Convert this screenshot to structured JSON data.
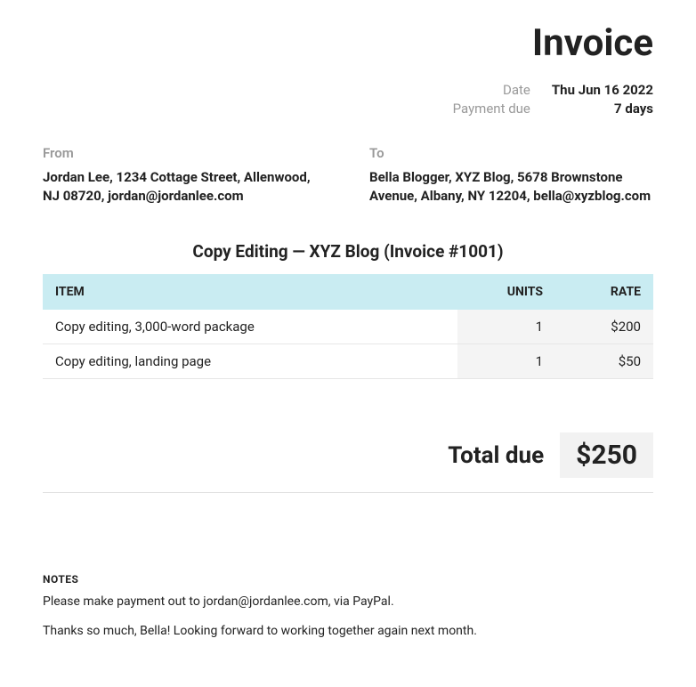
{
  "title": "Invoice",
  "meta": {
    "date_label": "Date",
    "date_value": "Thu Jun 16 2022",
    "payment_due_label": "Payment due",
    "payment_due_value": "7 days"
  },
  "from": {
    "label": "From",
    "details": "Jordan Lee, 1234 Cottage Street, Allenwood, NJ 08720, jordan@jordanlee.com"
  },
  "to": {
    "label": "To",
    "details": "Bella Blogger, XYZ Blog, 5678 Brownstone Avenue, Albany, NY 12204, bella@xyzblog.com"
  },
  "invoice_heading": "Copy Editing — XYZ Blog (Invoice #1001)",
  "table": {
    "headers": {
      "item": "ITEM",
      "units": "UNITS",
      "rate": "RATE"
    },
    "rows": [
      {
        "item": "Copy editing, 3,000-word package",
        "units": "1",
        "rate": "$200"
      },
      {
        "item": "Copy editing, landing page",
        "units": "1",
        "rate": "$50"
      }
    ]
  },
  "total": {
    "label": "Total due",
    "value": "$250"
  },
  "notes": {
    "heading": "NOTES",
    "line1": "Please make payment out to jordan@jordanlee.com, via PayPal.",
    "line2": "Thanks so much, Bella! Looking forward to working together again next month."
  }
}
